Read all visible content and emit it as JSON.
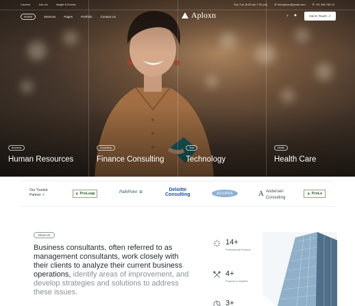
{
  "topbar": {
    "links": [
      "Careers",
      "Join Us",
      "Insight & Events"
    ],
    "hours": "Sun-Tue (9.00 am-7.00 pm)",
    "email": "Infoaploxn@gmail.com",
    "phone": "+91 456 786 12"
  },
  "nav": {
    "items": [
      "Home",
      "Services",
      "Pages",
      "Portfolio",
      "Contact Us"
    ],
    "active": "Home",
    "brand": "Aploxn",
    "cta_label": "Get In Touch",
    "cta_arrow": "↗",
    "search_glyph": "⌕",
    "theme_glyph": "✹"
  },
  "services": [
    {
      "tag": "Business",
      "title": "Human Resources"
    },
    {
      "tag": "Consulting",
      "title": "Finance Consulting"
    },
    {
      "tag": "Tech",
      "title": "Technology"
    },
    {
      "tag": "Health",
      "title": "Health Care"
    }
  ],
  "partners": {
    "label_line1": "Our Trusted",
    "label_line2": "Partner",
    "label_arrow": "↗",
    "logos": [
      "ProLeap",
      "PathPoint",
      "Deloitte",
      "Consulting",
      "AZURRA",
      "Andersen",
      "Consulting",
      "ProLe"
    ]
  },
  "about": {
    "tag": "About Us",
    "text_main": "Business consultants, often referred to as management consultants, work closely with their clients to analyze their current business operations,",
    "text_muted": " identify areas of improvement, and develop strategies and solutions to address these issues."
  },
  "stats": [
    {
      "num": "14+",
      "label": "Professional Experts",
      "icon": "sparkle-icon"
    },
    {
      "num": "4+",
      "label": "Projects Complete",
      "icon": "tools-icon"
    },
    {
      "num": "3+",
      "label": "",
      "icon": "chart-icon"
    }
  ],
  "colors": {
    "deloitte_blue": "#1d4fa0",
    "text": "#1f2a2e",
    "muted": "#8a9296"
  }
}
